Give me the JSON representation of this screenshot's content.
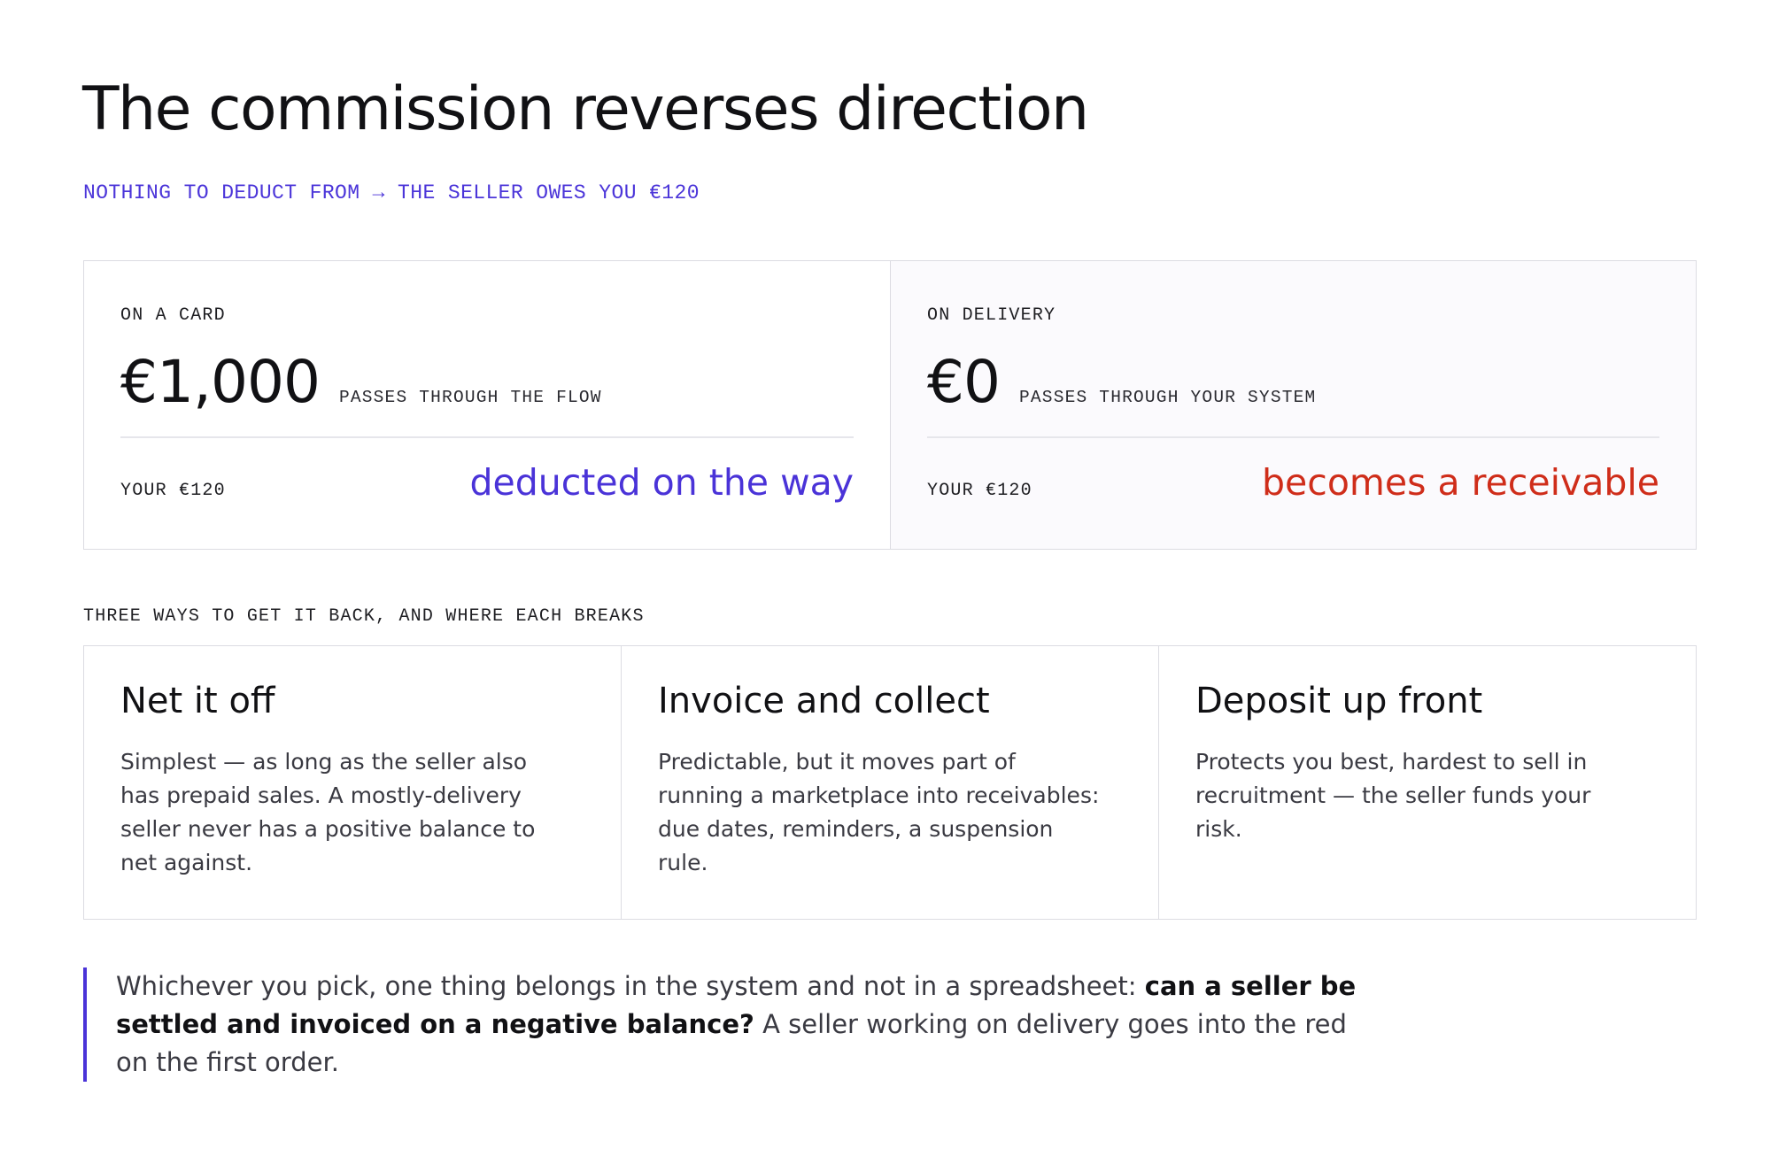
{
  "title": "The commission reverses direction",
  "subtitle": "NOTHING TO DEDUCT FROM → THE SELLER OWES YOU €120",
  "compare": {
    "card": {
      "label": "ON A CARD",
      "amount": "€1,000",
      "amount_note": "PASSES THROUGH THE FLOW",
      "your_label": "YOUR €120",
      "outcome": "deducted on the way",
      "outcome_color": "#4a33d8"
    },
    "delivery": {
      "label": "ON DELIVERY",
      "amount": "€0",
      "amount_note": "PASSES THROUGH YOUR SYSTEM",
      "your_label": "YOUR €120",
      "outcome": "becomes a receivable",
      "outcome_color": "#cf2d1a"
    }
  },
  "ways_label": "THREE WAYS TO GET IT BACK, AND WHERE EACH BREAKS",
  "ways": [
    {
      "title": "Net it off",
      "text": "Simplest — as long as the seller also has prepaid sales. A mostly-delivery seller never has a positive balance to net against."
    },
    {
      "title": "Invoice and collect",
      "text": "Predictable, but it moves part of running a marketplace into receivables: due dates, reminders, a suspension rule."
    },
    {
      "title": "Deposit up front",
      "text": "Protects you best, hardest to sell in recruitment — the seller funds your risk."
    }
  ],
  "quote": {
    "lead": "Whichever you pick, one thing belongs in the system and not in a spreadsheet: ",
    "bold": "can a seller be settled and invoiced on a negative balance?",
    "tail": " A seller working on delivery goes into the red on the first order.",
    "accent_color": "#4a33d8"
  }
}
